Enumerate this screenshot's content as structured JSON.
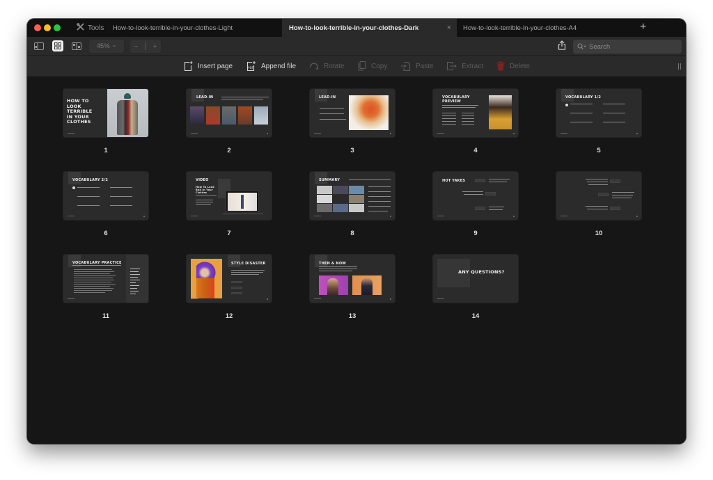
{
  "window": {
    "tools_label": "Tools",
    "tabs": [
      {
        "label": "How-to-look-terrible-in-your-clothes-Light",
        "active": false
      },
      {
        "label": "How-to-look-terrible-in-your-clothes-Dark",
        "active": true
      },
      {
        "label": "How-to-look-terrible-in-your-clothes-A4",
        "active": false
      }
    ],
    "close_glyph": "×",
    "new_tab_glyph": "+"
  },
  "toolbar": {
    "zoom_value": "45%",
    "zoom_caret": "⌄",
    "zoom_out": "−",
    "zoom_in": "+",
    "search_placeholder": "Search"
  },
  "actions": [
    {
      "label": "Insert page",
      "icon": "insert-page-icon",
      "enabled": true
    },
    {
      "label": "Append file",
      "icon": "append-pdf-icon",
      "enabled": true
    },
    {
      "label": "Rotate",
      "icon": "rotate-icon",
      "enabled": false
    },
    {
      "label": "Copy",
      "icon": "copy-icon",
      "enabled": false
    },
    {
      "label": "Paste",
      "icon": "paste-icon",
      "enabled": false
    },
    {
      "label": "Extract",
      "icon": "extract-icon",
      "enabled": false
    },
    {
      "label": "Delete",
      "icon": "trash-icon",
      "enabled": false
    }
  ],
  "pages": [
    {
      "number": "1",
      "title": "HOW TO LOOK TERRIBLE IN YOUR CLOTHES"
    },
    {
      "number": "2",
      "title": "LEAD-IN"
    },
    {
      "number": "3",
      "title": "LEAD-IN"
    },
    {
      "number": "4",
      "title": "VOCABULARY PREVIEW"
    },
    {
      "number": "5",
      "title": "VOCABULARY 1/2"
    },
    {
      "number": "6",
      "title": "VOCABULARY 2/2"
    },
    {
      "number": "7",
      "title": "VIDEO",
      "subtitle": "How To Look Bad In Your Clothes"
    },
    {
      "number": "8",
      "title": "SUMMARY"
    },
    {
      "number": "9",
      "title": "HOT TAKES"
    },
    {
      "number": "10",
      "title": ""
    },
    {
      "number": "11",
      "title": "VOCABULARY PRACTICE"
    },
    {
      "number": "12",
      "title": "STYLE DISASTER"
    },
    {
      "number": "13",
      "title": "THEN & NOW"
    },
    {
      "number": "14",
      "title": "ANY QUESTIONS?"
    }
  ],
  "colors": {
    "accent_red": "#fe5f57",
    "accent_yellow": "#febc2e",
    "accent_green": "#28c840",
    "delete_red": "#7a2323"
  }
}
